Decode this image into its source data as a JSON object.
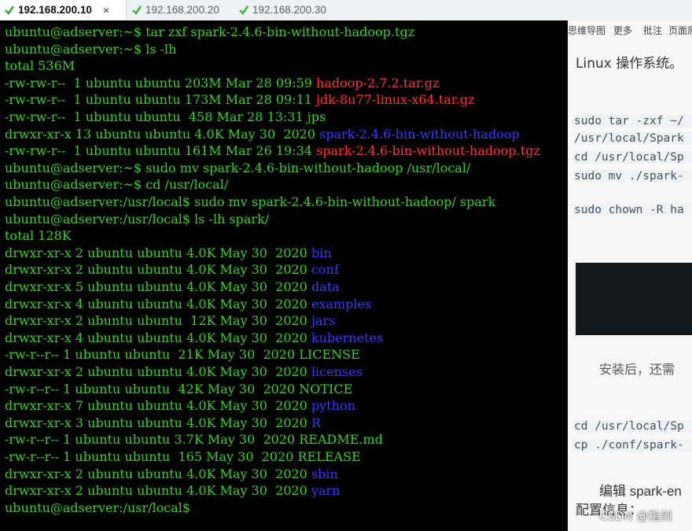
{
  "tabs": [
    {
      "label": "192.168.200.10",
      "active": true,
      "close": "×"
    },
    {
      "label": "192.168.200.20",
      "active": false
    },
    {
      "label": "192.168.200.30",
      "active": false
    }
  ],
  "colors": {
    "prompt": "#3ed02a",
    "archive": "#ff3535",
    "directory": "#3a3aff",
    "background": "#000000"
  },
  "terminal": {
    "lines": [
      [
        {
          "t": "ubuntu@adserver:~$ tar zxf spark-2.4.6-bin-without-hadoop.tgz",
          "c": "green"
        }
      ],
      [
        {
          "t": "ubuntu@adserver:~$ ls -lh",
          "c": "green"
        }
      ],
      [
        {
          "t": "total 536M",
          "c": "green"
        }
      ],
      [
        {
          "t": "-rw-rw-r--  1 ubuntu ubuntu 203M Mar 28 09:59 ",
          "c": "green"
        },
        {
          "t": "hadoop-2.7.2.tar.gz",
          "c": "red"
        }
      ],
      [
        {
          "t": "-rw-rw-r--  1 ubuntu ubuntu 173M Mar 28 09:11 ",
          "c": "green"
        },
        {
          "t": "jdk-8u77-linux-x64.tar.gz",
          "c": "red"
        }
      ],
      [
        {
          "t": "-rw-rw-r--  1 ubuntu ubuntu  458 Mar 28 13:31 jps",
          "c": "green"
        }
      ],
      [
        {
          "t": "drwxr-xr-x 13 ubuntu ubuntu 4.0K May 30  2020 ",
          "c": "green"
        },
        {
          "t": "spark-2.4.6-bin-without-hadoop",
          "c": "blue"
        }
      ],
      [
        {
          "t": "-rw-rw-r--  1 ubuntu ubuntu 161M Mar 26 19:34 ",
          "c": "green"
        },
        {
          "t": "spark-2.4.6-bin-without-hadoop.tgz",
          "c": "red"
        }
      ],
      [
        {
          "t": "ubuntu@adserver:~$ sudo mv spark-2.4.6-bin-without-hadoop /usr/local/",
          "c": "green"
        }
      ],
      [
        {
          "t": "ubuntu@adserver:~$ cd /usr/local/",
          "c": "green"
        }
      ],
      [
        {
          "t": "ubuntu@adserver:/usr/local$ sudo mv spark-2.4.6-bin-without-hadoop/ spark",
          "c": "green"
        }
      ],
      [
        {
          "t": "ubuntu@adserver:/usr/local$ ls -lh spark/",
          "c": "green"
        }
      ],
      [
        {
          "t": "total 128K",
          "c": "green"
        }
      ],
      [
        {
          "t": "drwxr-xr-x 2 ubuntu ubuntu 4.0K May 30  2020 ",
          "c": "green"
        },
        {
          "t": "bin",
          "c": "blue"
        }
      ],
      [
        {
          "t": "drwxr-xr-x 2 ubuntu ubuntu 4.0K May 30  2020 ",
          "c": "green"
        },
        {
          "t": "conf",
          "c": "blue"
        }
      ],
      [
        {
          "t": "drwxr-xr-x 5 ubuntu ubuntu 4.0K May 30  2020 ",
          "c": "green"
        },
        {
          "t": "data",
          "c": "blue"
        }
      ],
      [
        {
          "t": "drwxr-xr-x 4 ubuntu ubuntu 4.0K May 30  2020 ",
          "c": "green"
        },
        {
          "t": "examples",
          "c": "blue"
        }
      ],
      [
        {
          "t": "drwxr-xr-x 2 ubuntu ubuntu  12K May 30  2020 ",
          "c": "green"
        },
        {
          "t": "jars",
          "c": "blue"
        }
      ],
      [
        {
          "t": "drwxr-xr-x 4 ubuntu ubuntu 4.0K May 30  2020 ",
          "c": "green"
        },
        {
          "t": "kubernetes",
          "c": "blue"
        }
      ],
      [
        {
          "t": "-rw-r--r-- 1 ubuntu ubuntu  21K May 30  2020 LICENSE",
          "c": "green"
        }
      ],
      [
        {
          "t": "drwxr-xr-x 2 ubuntu ubuntu 4.0K May 30  2020 ",
          "c": "green"
        },
        {
          "t": "licenses",
          "c": "blue"
        }
      ],
      [
        {
          "t": "-rw-r--r-- 1 ubuntu ubuntu  42K May 30  2020 NOTICE",
          "c": "green"
        }
      ],
      [
        {
          "t": "drwxr-xr-x 7 ubuntu ubuntu 4.0K May 30  2020 ",
          "c": "green"
        },
        {
          "t": "python",
          "c": "blue"
        }
      ],
      [
        {
          "t": "drwxr-xr-x 3 ubuntu ubuntu 4.0K May 30  2020 ",
          "c": "green"
        },
        {
          "t": "R",
          "c": "blue"
        }
      ],
      [
        {
          "t": "-rw-r--r-- 1 ubuntu ubuntu 3.7K May 30  2020 README.md",
          "c": "green"
        }
      ],
      [
        {
          "t": "-rw-r--r-- 1 ubuntu ubuntu  165 May 30  2020 RELEASE",
          "c": "green"
        }
      ],
      [
        {
          "t": "drwxr-xr-x 2 ubuntu ubuntu 4.0K May 30  2020 ",
          "c": "green"
        },
        {
          "t": "sbin",
          "c": "blue"
        }
      ],
      [
        {
          "t": "drwxr-xr-x 2 ubuntu ubuntu 4.0K May 30  2020 ",
          "c": "green"
        },
        {
          "t": "yarn",
          "c": "blue"
        }
      ],
      [
        {
          "t": "ubuntu@adserver:/usr/local$ ",
          "c": "green"
        }
      ]
    ]
  },
  "background_doc": {
    "menu": [
      "思维导图",
      "更多",
      "批注",
      "页面原 "
    ],
    "heading": "Linux 操作系统。",
    "code_lines": [
      "sudo tar -zxf ~/",
      "/usr/local/Spark",
      "cd /usr/local/Sp",
      "sudo mv ./spark-",
      "sudo chown -R ha",
      "cd /usr/local/Sp",
      "cp ./conf/spark-"
    ],
    "text_lines": [
      "安装后，还需",
      "编辑 spark-en",
      "配置信息："
    ]
  },
  "watermark": "CSDN @指剑"
}
